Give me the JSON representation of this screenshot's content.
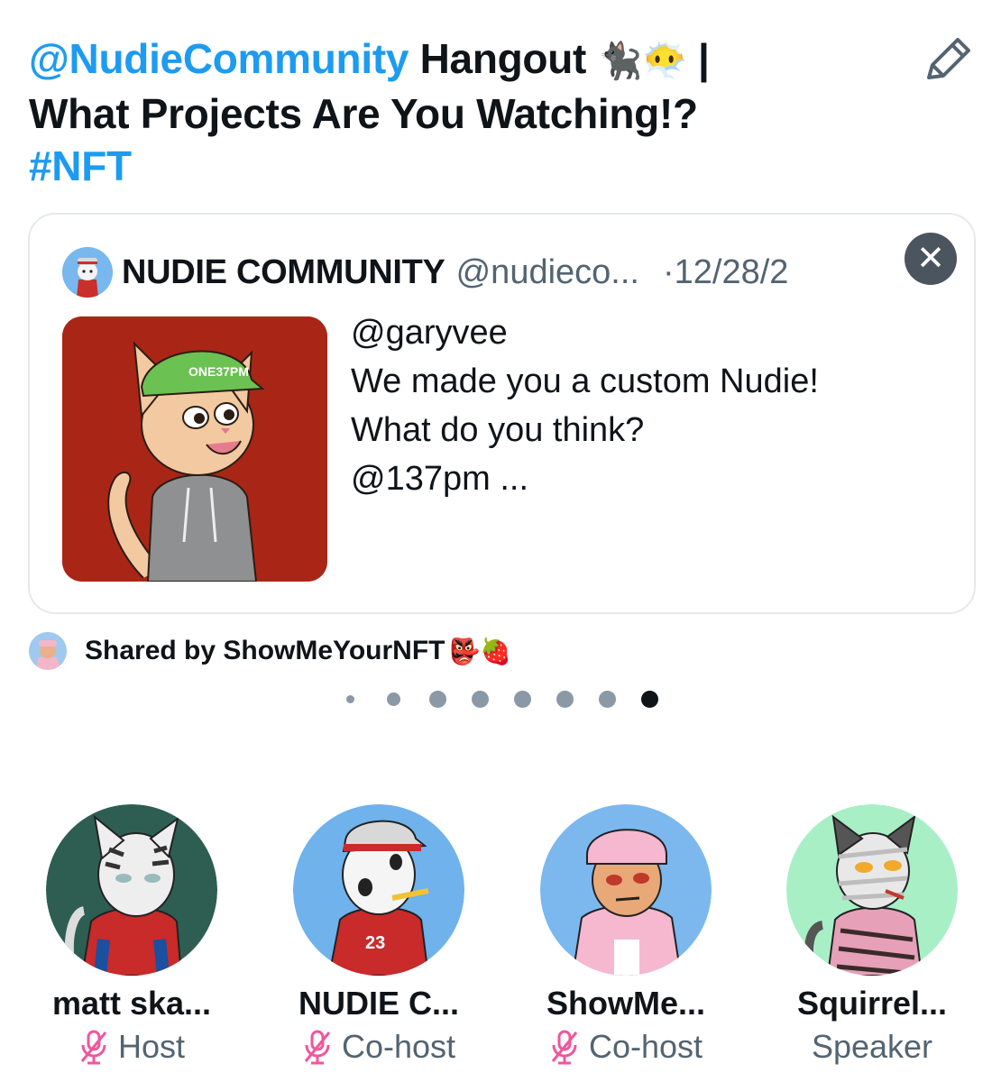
{
  "space": {
    "title_mention": "@NudieCommunity",
    "title_rest": " Hangout ",
    "title_emoji": "🐈‍⬛😶‍🌫️",
    "title_sep": " |",
    "title_line2": "What Projects Are You Watching!?",
    "title_hashtag": "#NFT",
    "edit_icon": "pencil-icon"
  },
  "tweet": {
    "author_name": "NUDIE COMMUNITY",
    "author_handle": "@nudieco...",
    "date": "·12/28/2",
    "close_icon": "close-icon",
    "close_label": "✕",
    "lines": [
      "@garyvee",
      "We made you a custom Nudie!",
      "What do you think?",
      "@137pm ..."
    ],
    "cap_text": "ONE37PM"
  },
  "shared": {
    "label": "Shared by ShowMeYourNFT",
    "emoji": "👺🍓"
  },
  "pagination": {
    "total": 8,
    "active": 8
  },
  "participants": [
    {
      "name": "matt ska...",
      "role": "Host",
      "muted": true,
      "bg": "#2e5e52"
    },
    {
      "name": "NUDIE C...",
      "role": "Co-host",
      "muted": true,
      "bg": "#6fb2ec"
    },
    {
      "name": "ShowMe...",
      "role": "Co-host",
      "muted": true,
      "bg": "#7cb8ee"
    },
    {
      "name": "Squirrel...",
      "role": "Speaker",
      "muted": false,
      "bg": "#a9efc6"
    }
  ],
  "colors": {
    "accent": "#1d9bf0",
    "muted_mic": "#f0569d",
    "secondary_text": "#536471"
  }
}
